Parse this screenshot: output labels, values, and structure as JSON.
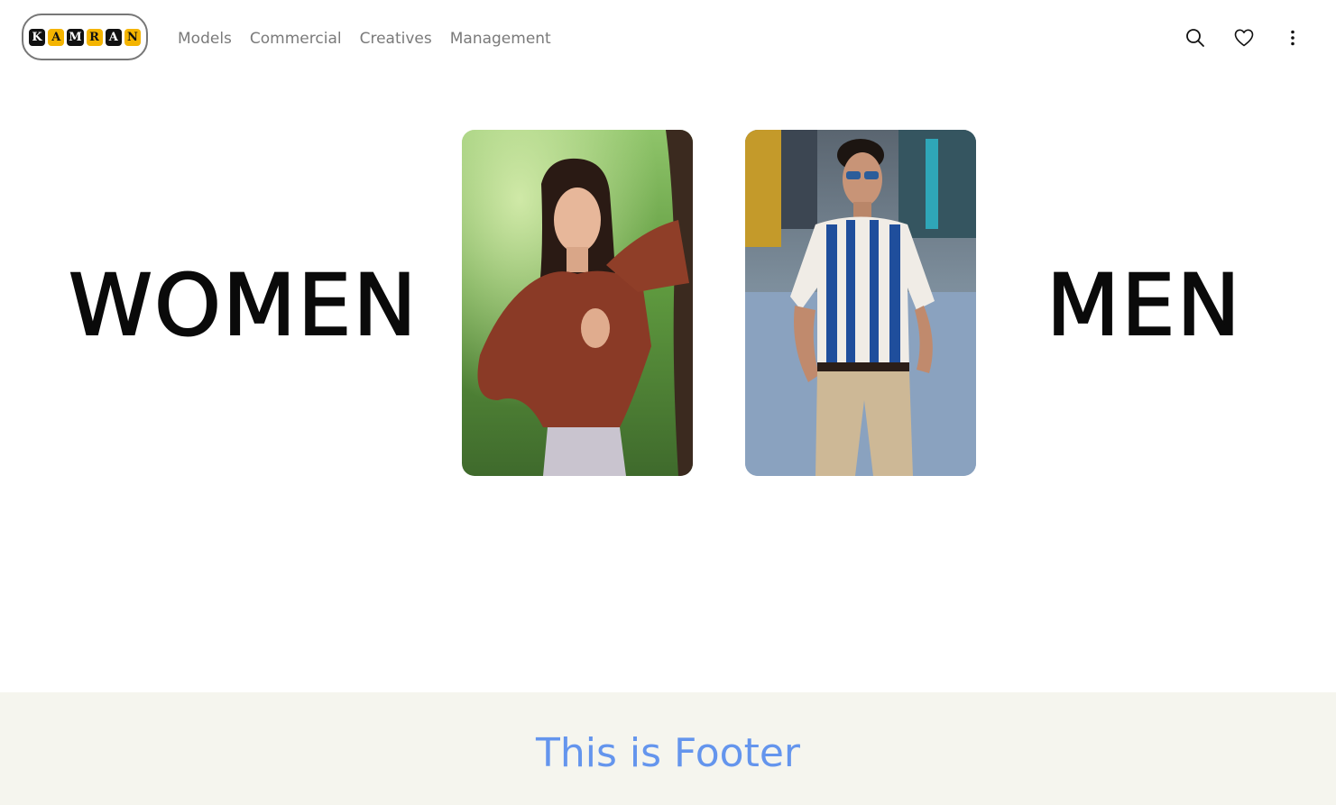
{
  "logo": {
    "letters": [
      "K",
      "A",
      "M",
      "R",
      "A",
      "N"
    ]
  },
  "nav": {
    "items": [
      {
        "label": "Models"
      },
      {
        "label": "Commercial"
      },
      {
        "label": "Creatives"
      },
      {
        "label": "Management"
      }
    ]
  },
  "icons": {
    "search": "search-icon",
    "favorites": "heart-icon",
    "menu": "more-vertical-icon"
  },
  "hero": {
    "left_label": "WOMEN",
    "right_label": "MEN"
  },
  "footer": {
    "text": "This is Footer"
  },
  "colors": {
    "nav_text": "#7a7a7a",
    "footer_bg": "#f5f5ee",
    "footer_text": "#6495ed",
    "logo_gold": "#f4b400"
  }
}
